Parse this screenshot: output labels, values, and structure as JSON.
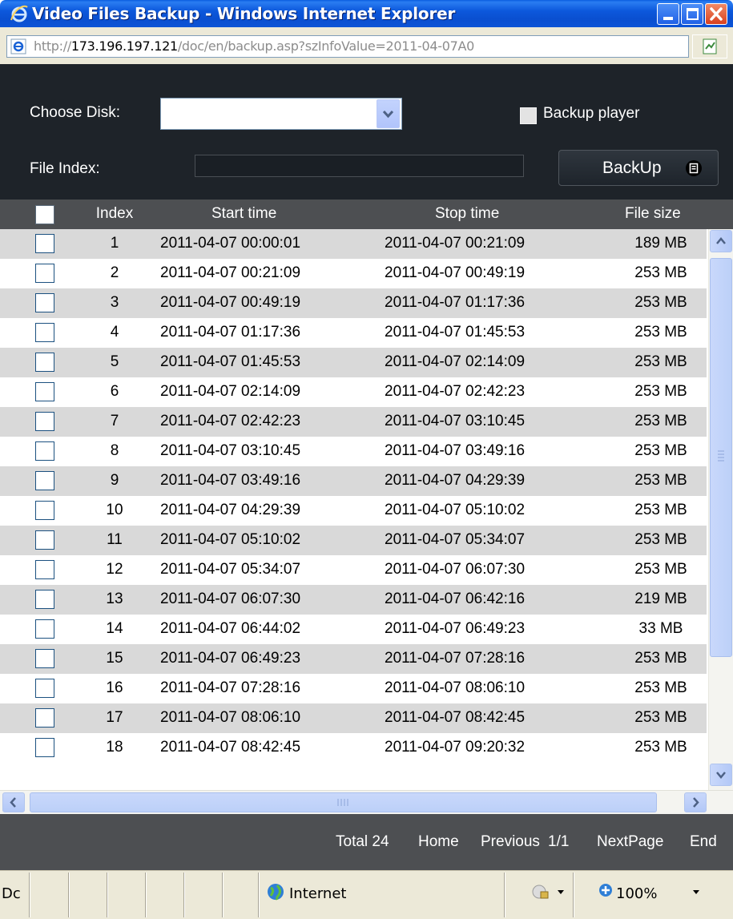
{
  "window": {
    "title": "Video Files Backup - Windows Internet Explorer"
  },
  "address": {
    "prefix": "http://",
    "host": "173.196.197.121",
    "path": "/doc/en/backup.asp?szInfoValue=2011-04-07A0"
  },
  "controls": {
    "choose_disk_label": "Choose Disk:",
    "disk_value": "",
    "backup_player_label": "Backup player",
    "backup_player_checked": false,
    "file_index_label": "File Index:",
    "file_index_progress": 0,
    "backup_button_label": "BackUp"
  },
  "table": {
    "headers": {
      "index": "Index",
      "start": "Start time",
      "stop": "Stop time",
      "size": "File size"
    },
    "rows": [
      {
        "index": "1",
        "start": "2011-04-07 00:00:01",
        "stop": "2011-04-07 00:21:09",
        "size": "189 MB"
      },
      {
        "index": "2",
        "start": "2011-04-07 00:21:09",
        "stop": "2011-04-07 00:49:19",
        "size": "253 MB"
      },
      {
        "index": "3",
        "start": "2011-04-07 00:49:19",
        "stop": "2011-04-07 01:17:36",
        "size": "253 MB"
      },
      {
        "index": "4",
        "start": "2011-04-07 01:17:36",
        "stop": "2011-04-07 01:45:53",
        "size": "253 MB"
      },
      {
        "index": "5",
        "start": "2011-04-07 01:45:53",
        "stop": "2011-04-07 02:14:09",
        "size": "253 MB"
      },
      {
        "index": "6",
        "start": "2011-04-07 02:14:09",
        "stop": "2011-04-07 02:42:23",
        "size": "253 MB"
      },
      {
        "index": "7",
        "start": "2011-04-07 02:42:23",
        "stop": "2011-04-07 03:10:45",
        "size": "253 MB"
      },
      {
        "index": "8",
        "start": "2011-04-07 03:10:45",
        "stop": "2011-04-07 03:49:16",
        "size": "253 MB"
      },
      {
        "index": "9",
        "start": "2011-04-07 03:49:16",
        "stop": "2011-04-07 04:29:39",
        "size": "253 MB"
      },
      {
        "index": "10",
        "start": "2011-04-07 04:29:39",
        "stop": "2011-04-07 05:10:02",
        "size": "253 MB"
      },
      {
        "index": "11",
        "start": "2011-04-07 05:10:02",
        "stop": "2011-04-07 05:34:07",
        "size": "253 MB"
      },
      {
        "index": "12",
        "start": "2011-04-07 05:34:07",
        "stop": "2011-04-07 06:07:30",
        "size": "253 MB"
      },
      {
        "index": "13",
        "start": "2011-04-07 06:07:30",
        "stop": "2011-04-07 06:42:16",
        "size": "219 MB"
      },
      {
        "index": "14",
        "start": "2011-04-07 06:44:02",
        "stop": "2011-04-07 06:49:23",
        "size": "33 MB"
      },
      {
        "index": "15",
        "start": "2011-04-07 06:49:23",
        "stop": "2011-04-07 07:28:16",
        "size": "253 MB"
      },
      {
        "index": "16",
        "start": "2011-04-07 07:28:16",
        "stop": "2011-04-07 08:06:10",
        "size": "253 MB"
      },
      {
        "index": "17",
        "start": "2011-04-07 08:06:10",
        "stop": "2011-04-07 08:42:45",
        "size": "253 MB"
      },
      {
        "index": "18",
        "start": "2011-04-07 08:42:45",
        "stop": "2011-04-07 09:20:32",
        "size": "253 MB"
      }
    ]
  },
  "pager": {
    "total": "Total 24",
    "home": "Home",
    "previous": "Previous",
    "page": "1/1",
    "next": "NextPage",
    "end": "End"
  },
  "status": {
    "left_text": "Dc",
    "zone": "Internet",
    "zoom": "100%"
  },
  "icons": {
    "ie": "ie-logo-icon",
    "page": "page-icon",
    "go": "compatibility-icon",
    "backup": "save-disk-icon",
    "globe": "globe-icon",
    "protected": "protected-mode-icon",
    "zoom": "zoom-icon"
  },
  "colors": {
    "titlebar": "#0c58dc",
    "panel": "#1e2329",
    "table_header": "#4d4f52",
    "row_alt": "#d9d9d9",
    "chrome": "#ece9d8"
  }
}
